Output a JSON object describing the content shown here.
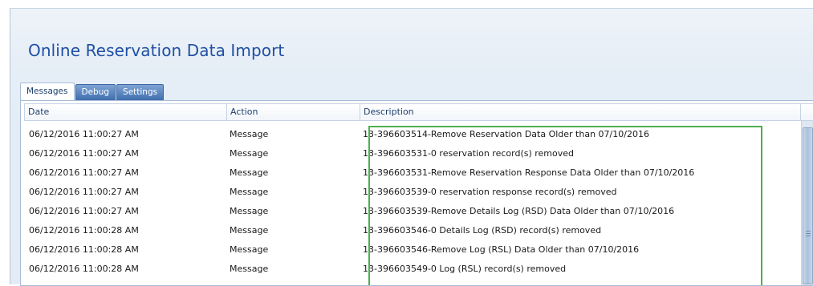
{
  "window": {
    "title": "Online Reservation Data Import"
  },
  "tabs": [
    {
      "label": "Messages",
      "active": true
    },
    {
      "label": "Debug",
      "active": false
    },
    {
      "label": "Settings",
      "active": false
    }
  ],
  "grid": {
    "columns": [
      "Date",
      "Action",
      "Description"
    ],
    "rows": [
      {
        "date": "06/12/2016 11:00:27 AM",
        "action": "Message",
        "description": "13-396603514-Remove Reservation Data Older than 07/10/2016"
      },
      {
        "date": "06/12/2016 11:00:27 AM",
        "action": "Message",
        "description": "13-396603531-0 reservation record(s) removed"
      },
      {
        "date": "06/12/2016 11:00:27 AM",
        "action": "Message",
        "description": "13-396603531-Remove Reservation Response Data Older than 07/10/2016"
      },
      {
        "date": "06/12/2016 11:00:27 AM",
        "action": "Message",
        "description": "13-396603539-0 reservation response record(s) removed"
      },
      {
        "date": "06/12/2016 11:00:27 AM",
        "action": "Message",
        "description": "13-396603539-Remove Details Log (RSD) Data Older than 07/10/2016"
      },
      {
        "date": "06/12/2016 11:00:28 AM",
        "action": "Message",
        "description": "13-396603546-0 Details Log (RSD) record(s) removed"
      },
      {
        "date": "06/12/2016 11:00:28 AM",
        "action": "Message",
        "description": "13-396603546-Remove Log (RSL) Data Older than 07/10/2016"
      },
      {
        "date": "06/12/2016 11:00:28 AM",
        "action": "Message",
        "description": "13-396603549-0 Log (RSL) record(s) removed"
      }
    ]
  },
  "colors": {
    "title": "#1f4fa3",
    "highlight_box": "#4caf50",
    "tab_inactive": "#3f6fb0"
  }
}
